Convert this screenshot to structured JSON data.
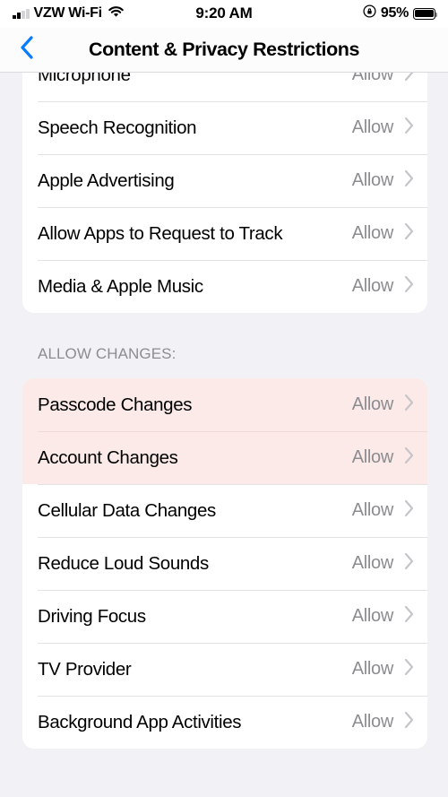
{
  "status_bar": {
    "signal_icon": "cellular-signal-icon",
    "signal_bars_filled": 2,
    "signal_bars_total": 4,
    "carrier": "VZW Wi-Fi",
    "wifi_icon": "wifi-icon",
    "time": "9:20 AM",
    "rotation_lock_icon": "rotation-lock-icon",
    "battery_percent": "95%",
    "battery_icon": "battery-full-icon",
    "battery_level": 95
  },
  "nav": {
    "back_icon": "chevron-left-icon",
    "title": "Content & Privacy Restrictions"
  },
  "colors": {
    "page_background": "#F1F1F6",
    "card_background": "#FFFFFF",
    "highlight_background": "#FBEAE8",
    "accent_blue": "#0A7CFF",
    "value_gray": "#8C8C91",
    "chevron_gray": "#C4C4C9",
    "separator": "#E3E3E6"
  },
  "sections": [
    {
      "header": "",
      "clipped_top": true,
      "rows": [
        {
          "label": "Microphone",
          "value": "Allow",
          "chevron": "chevron-right-icon",
          "highlighted": false
        },
        {
          "label": "Speech Recognition",
          "value": "Allow",
          "chevron": "chevron-right-icon",
          "highlighted": false
        },
        {
          "label": "Apple Advertising",
          "value": "Allow",
          "chevron": "chevron-right-icon",
          "highlighted": false
        },
        {
          "label": "Allow Apps to Request to Track",
          "value": "Allow",
          "chevron": "chevron-right-icon",
          "highlighted": false
        },
        {
          "label": "Media & Apple Music",
          "value": "Allow",
          "chevron": "chevron-right-icon",
          "highlighted": false
        }
      ]
    },
    {
      "header": "ALLOW CHANGES:",
      "clipped_top": false,
      "rows": [
        {
          "label": "Passcode Changes",
          "value": "Allow",
          "chevron": "chevron-right-icon",
          "highlighted": true
        },
        {
          "label": "Account Changes",
          "value": "Allow",
          "chevron": "chevron-right-icon",
          "highlighted": true
        },
        {
          "label": "Cellular Data Changes",
          "value": "Allow",
          "chevron": "chevron-right-icon",
          "highlighted": false
        },
        {
          "label": "Reduce Loud Sounds",
          "value": "Allow",
          "chevron": "chevron-right-icon",
          "highlighted": false
        },
        {
          "label": "Driving Focus",
          "value": "Allow",
          "chevron": "chevron-right-icon",
          "highlighted": false
        },
        {
          "label": "TV Provider",
          "value": "Allow",
          "chevron": "chevron-right-icon",
          "highlighted": false
        },
        {
          "label": "Background App Activities",
          "value": "Allow",
          "chevron": "chevron-right-icon",
          "highlighted": false
        }
      ]
    }
  ]
}
